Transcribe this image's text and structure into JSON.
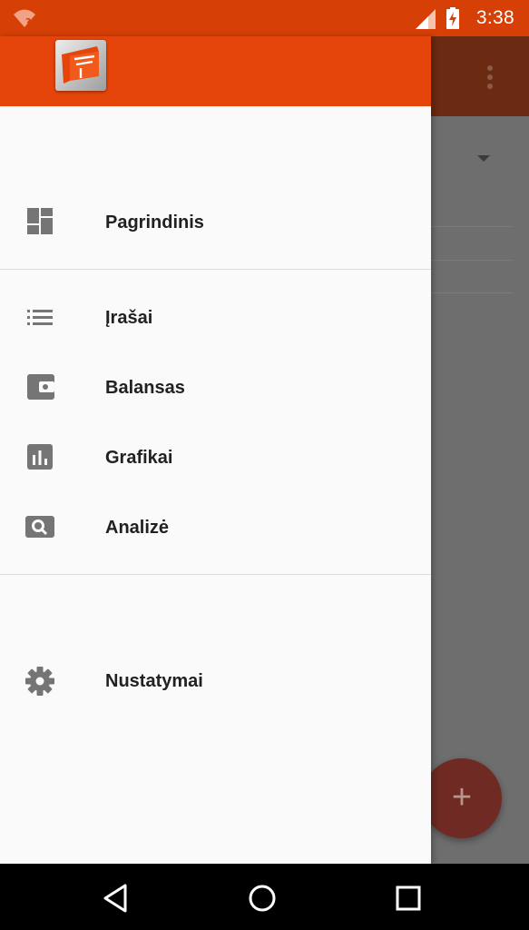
{
  "status_bar": {
    "time": "3:38",
    "background_color": "#d63f06",
    "icons": [
      "wifi-unknown-icon",
      "cell-signal-icon",
      "battery-charging-icon"
    ]
  },
  "drawer": {
    "header_color": "#e5440a",
    "logo": "app-logo-icon",
    "items": [
      {
        "label": "Pagrindinis",
        "icon": "dashboard-icon"
      },
      {
        "label": "Įrašai",
        "icon": "list-icon"
      },
      {
        "label": "Balansas",
        "icon": "wallet-icon"
      },
      {
        "label": "Grafikai",
        "icon": "bar-chart-icon"
      },
      {
        "label": "Analizė",
        "icon": "search-icon"
      },
      {
        "label": "Nustatymai",
        "icon": "gear-icon"
      }
    ]
  },
  "background_app": {
    "toolbar_icon": "more-vert-icon",
    "dropdown_icon": "dropdown-arrow-icon",
    "fab_icon": "add-icon"
  },
  "system_nav": {
    "buttons": [
      "back-icon",
      "home-icon",
      "recents-icon"
    ]
  }
}
